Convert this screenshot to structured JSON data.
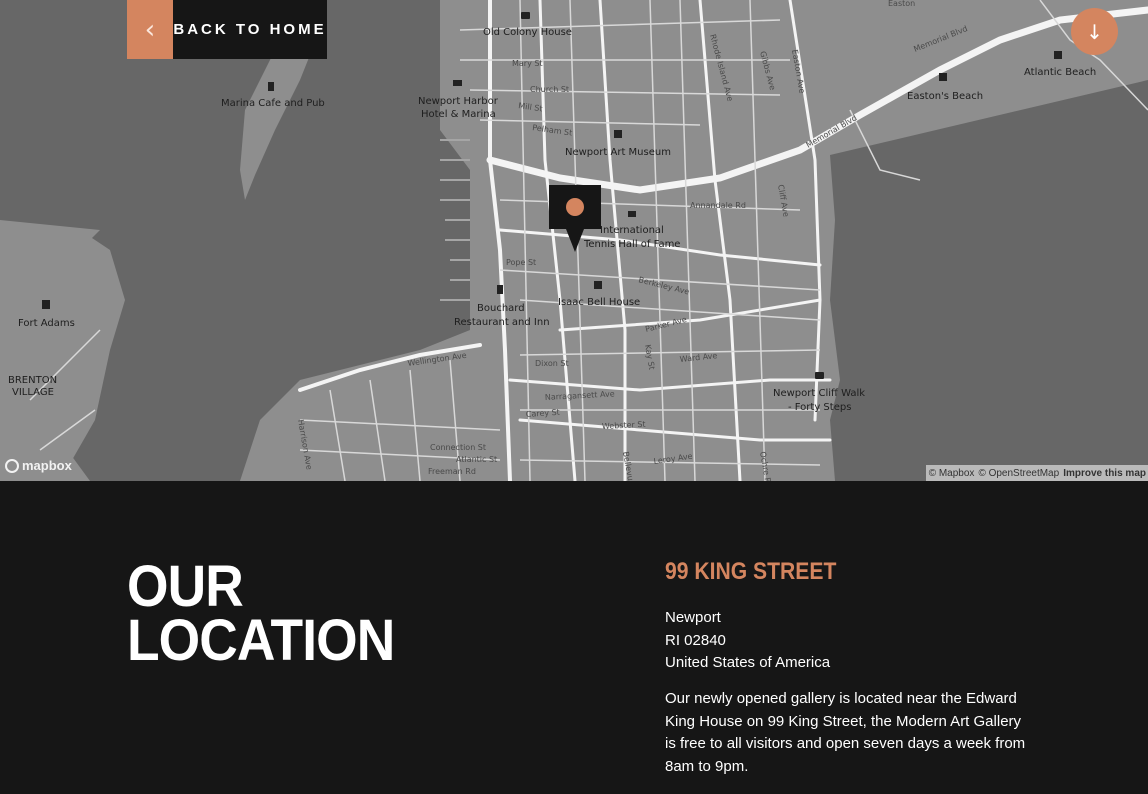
{
  "map": {
    "labels": {
      "old_colony": "Old Colony House",
      "marina_cafe": "Marina Cafe and Pub",
      "harbor_hotel_1": "Newport Harbor",
      "harbor_hotel_2": "Hotel & Marina",
      "art_museum": "Newport Art Museum",
      "tennis_1": "International",
      "tennis_2": "Tennis Hall of Fame",
      "bouchard_1": "Bouchard",
      "bouchard_2": "Restaurant and Inn",
      "isaac_bell": "Isaac Bell House",
      "fort_adams": "Fort Adams",
      "brenton_1": "BRENTON",
      "brenton_2": "VILLAGE",
      "cliff_walk_1": "Newport Cliff Walk",
      "cliff_walk_2": "- Forty Steps",
      "eastons_beach": "Easton's Beach",
      "atlantic_beach": "Atlantic Beach"
    },
    "streets": {
      "memorial_blvd_1": "Memorial Blvd",
      "memorial_blvd_2": "Memorial Blvd",
      "wellington": "Wellington Ave",
      "narragansett": "Narragansett Ave",
      "webster": "Webster St",
      "leroy": "Leroy Ave",
      "mary": "Mary St",
      "church": "Church St",
      "mill": "Mill St",
      "pelham": "Pelham St",
      "pope": "Pope St",
      "dixon": "Dixon St",
      "berkeley": "Berkeley Ave",
      "parker": "Parker Ave",
      "ward": "Ward Ave",
      "kay": "Kay St",
      "rhode_island": "Rhode Island Ave",
      "gibbs": "Gibbs Ave",
      "easton": "Easton Ave",
      "cliff": "Cliff Ave",
      "mann": "Mann Ave",
      "carey": "Carey St",
      "harrison": "Harrison Ave",
      "bowery": "Bowery St",
      "fillmore": "Fillmore St",
      "ochre": "Ochre Pt",
      "narragansett_v": "Bellevue",
      "cross": "Cross",
      "yznaga": "Yznaga",
      "annandale": "Annandale Rd",
      "connection": "Connection St",
      "atlantic": "Atlantic St",
      "freeman": "Freeman Rd",
      "lee": "Lee St",
      "everett": "Everett",
      "beacon": "Beacon Hill Rd",
      "catherine": "Catherine St",
      "bull": "Bull St",
      "clarke": "Clarke St",
      "hunter": "Hunter Ave",
      "leroy_v": "Lawrence Ave",
      "kingston": "Kingston Ave",
      "memorial_top": "Easton"
    },
    "attribution": {
      "mapbox": "© Mapbox",
      "osm": "© OpenStreetMap",
      "improve": "Improve this map"
    },
    "logo_text": "mapbox",
    "colors": {
      "land": "#8e8e8e",
      "water": "#676767",
      "roads": "#f4f4f4",
      "marker": "#161616",
      "marker_dot": "#d4855f"
    }
  },
  "nav": {
    "back_arrow": "‹",
    "back_label": "BACK TO HOME",
    "down_arrow": "↓",
    "accent": "#d4855f"
  },
  "location": {
    "heading_line1": "OUR",
    "heading_line2": "LOCATION",
    "street": "99 KING STREET",
    "city": "Newport",
    "zip": "RI 02840",
    "country": "United States of America",
    "description": "Our newly opened gallery is located near the Edward King House on 99 King Street, the Modern Art Gallery is free to all visitors and open seven days a week from 8am to 9pm."
  }
}
